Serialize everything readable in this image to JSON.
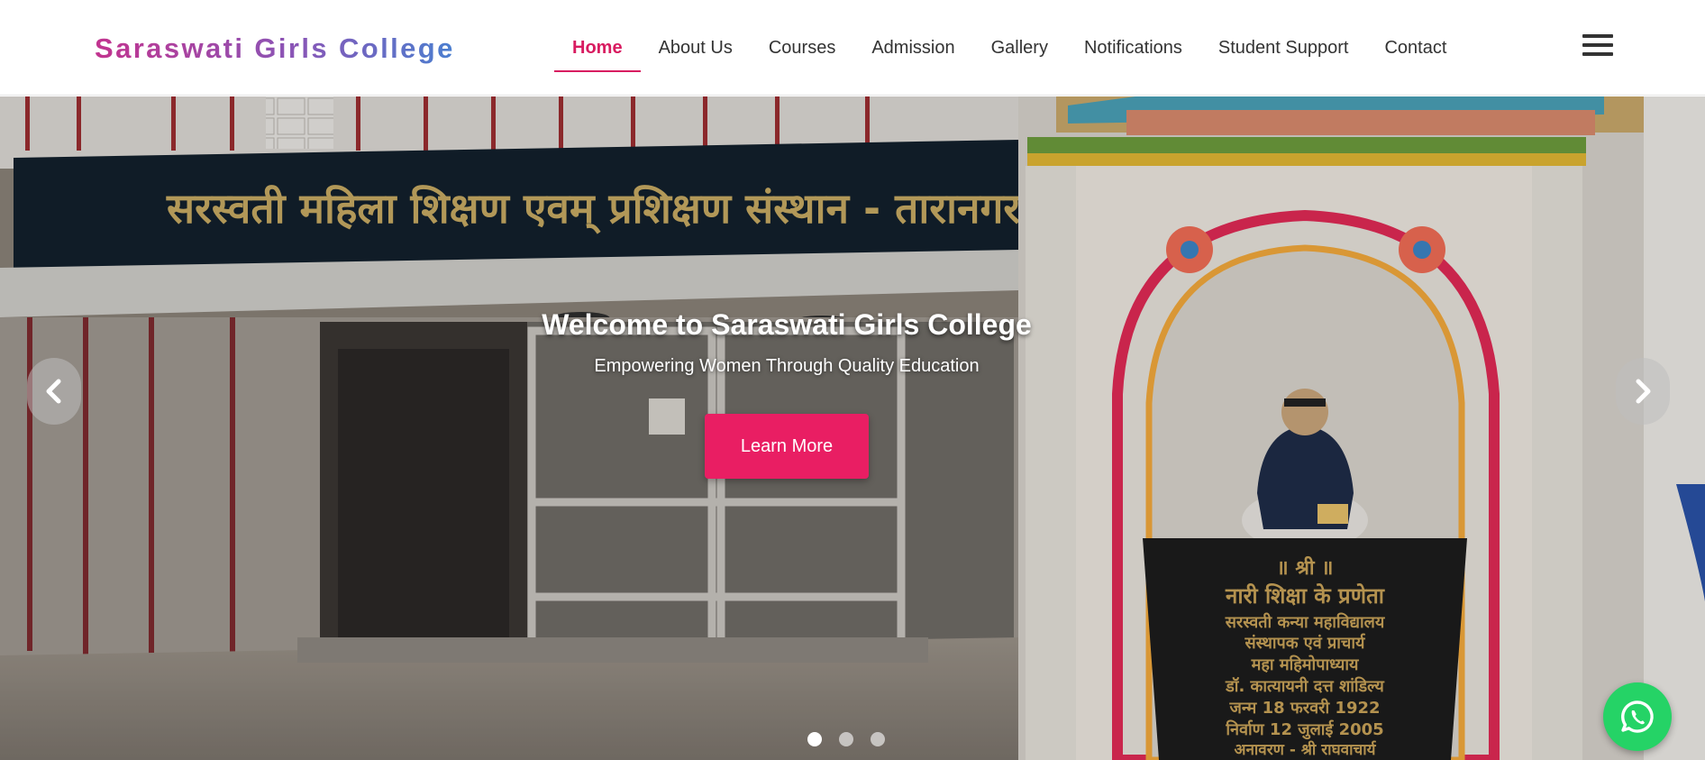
{
  "brand": {
    "name": "Saraswati Girls College"
  },
  "nav": {
    "items": [
      {
        "label": "Home",
        "active": true
      },
      {
        "label": "About Us"
      },
      {
        "label": "Courses"
      },
      {
        "label": "Admission"
      },
      {
        "label": "Gallery"
      },
      {
        "label": "Notifications"
      },
      {
        "label": "Student Support"
      },
      {
        "label": "Contact"
      }
    ],
    "menu_icon": "hamburger-menu-icon"
  },
  "hero": {
    "title": "Welcome to Saraswati Girls College",
    "subtitle": "Empowering Women Through Quality Education",
    "cta_label": "Learn More",
    "signboard_text": "सरस्वती महिला शिक्षण एवम् प्रशिक्षण संस्थान - तारानगर",
    "plaque_lines": [
      "॥ श्री ॥",
      "नारी शिक्षा के प्रणेता",
      "सरस्वती कन्या महाविद्यालय",
      "संस्थापक एवं प्राचार्य",
      "महा महिमोपाध्याय",
      "डॉ. कात्यायनी दत्त शांडिल्य",
      "जन्म 18 फरवरी 1922",
      "निर्वाण 12 जुलाई 2005",
      "अनावरण - श्री राघवाचार्य"
    ],
    "prev_icon": "chevron-left-icon",
    "next_icon": "chevron-right-icon",
    "slide_count": 3,
    "active_slide": 1
  },
  "whatsapp": {
    "icon": "whatsapp-icon"
  },
  "colors": {
    "accent": "#e91e63",
    "whatsapp": "#25d366",
    "brand_start": "#c2348f",
    "brand_end": "#4a7fd0"
  }
}
